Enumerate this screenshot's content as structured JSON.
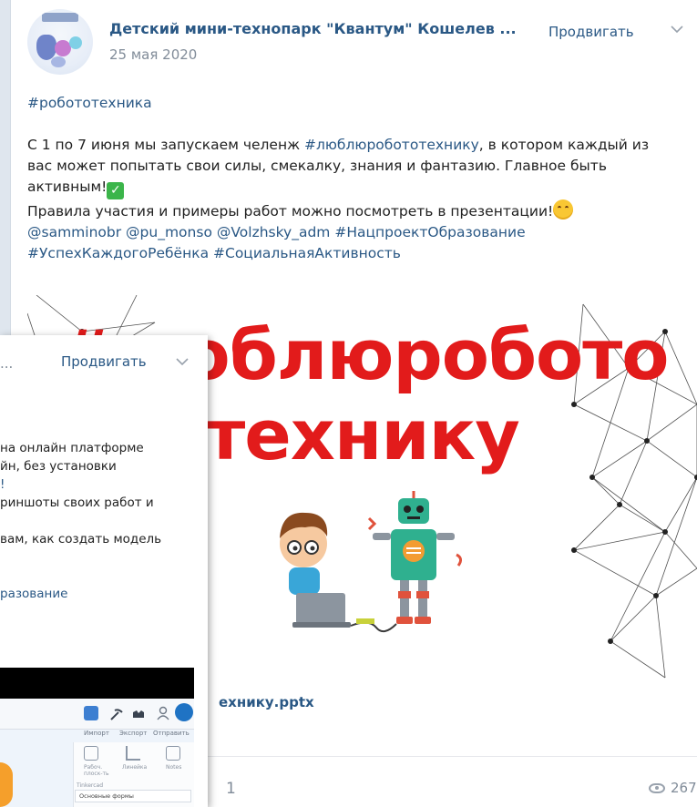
{
  "post": {
    "group_name": "Детский мини-технопарк \"Квантум\" Кошелев ...",
    "date": "25 мая 2020",
    "promote_label": "Продвигать",
    "hashtag_top": "#робототехника",
    "para1_start": "С 1 по 7 июня мы запускаем челенж ",
    "para1_tag": "#люблюробототехнику",
    "para1_mid": ", в котором каждый из",
    "para1_line2": "вас может попытать свои силы, смекалку, знания и фантазию. Главное быть",
    "para1_line3": "активным!",
    "para2": "Правила участия и примеры работ можно посмотреть в презентации!",
    "mentions": [
      "@samminobr",
      "@pu_monso",
      "@Volzhsky_adm",
      "#НацпроектОбразование"
    ],
    "tags_line": [
      "#УспехКаждогоРебёнка",
      "#СоциальнаяАктивность"
    ],
    "banner_line1": "#люблюробото",
    "banner_line2": "технику",
    "attachment_name": "ехнику.pptx",
    "likes": "1",
    "views": "267"
  },
  "overlay": {
    "ellipsis": "...",
    "promote_label": "Продвигать",
    "lines": [
      "на онлайн платформе",
      "йн, без установки",
      "!",
      "риншоты своих работ и",
      "",
      "вам, как создать модель",
      "",
      "",
      "разование"
    ],
    "app": {
      "import": "Импорт",
      "export": "Экспорт",
      "send": "Отправить",
      "work_plane": "Рабоч. плоск-ть",
      "ruler": "Линейка",
      "notes": "Notes",
      "shapes_caption": "Tinkercad",
      "shapes_select": "Основные формы"
    }
  },
  "colors": {
    "link": "#2a5885",
    "banner_red": "#e21b1b",
    "muted": "#818c99",
    "check_green": "#3bb54a"
  },
  "icons": [
    "chevron-down-icon",
    "check-mark-icon",
    "smile-emoji-icon",
    "eye-icon",
    "apps-grid-icon",
    "user-icon"
  ]
}
